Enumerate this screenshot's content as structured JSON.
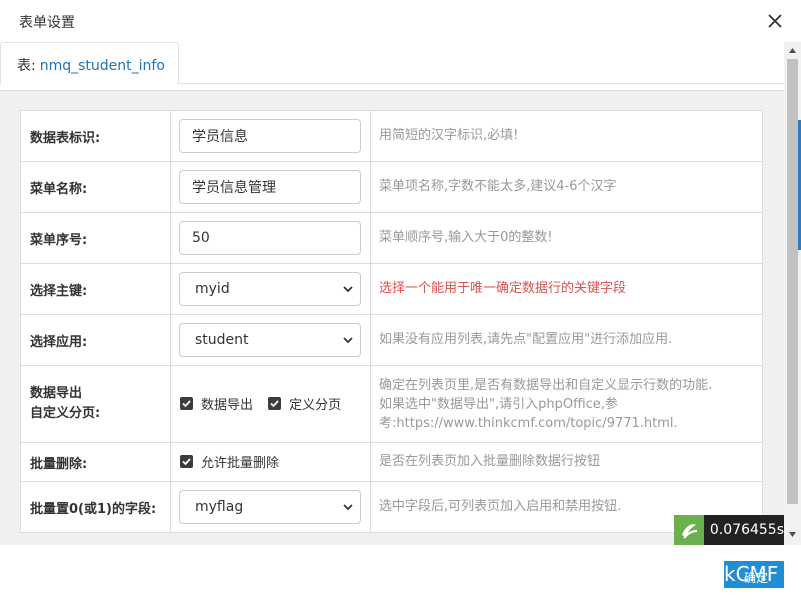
{
  "dialog": {
    "title": "表单设置"
  },
  "tab": {
    "prefix": "表:",
    "name": "nmq_student_info"
  },
  "rows": [
    {
      "label": "数据表标识:",
      "value": "学员信息",
      "hint": "用简短的汉字标识,必填!"
    },
    {
      "label": "菜单名称:",
      "value": "学员信息管理",
      "hint": "菜单项名称,字数不能太多,建议4-6个汉字"
    },
    {
      "label": "菜单序号:",
      "value": "50",
      "hint": "菜单顺序号,输入大于0的整数!"
    },
    {
      "label": "选择主键:",
      "value": "myid",
      "hint": "选择一个能用于唯一确定数据行的关键字段"
    },
    {
      "label": "选择应用:",
      "value": "student",
      "hint": "如果没有应用列表,请先点\"配置应用\"进行添加应用."
    },
    {
      "label_line1": "数据导出",
      "label_line2": "自定义分页:",
      "check1": "数据导出",
      "check2": "定义分页",
      "hint_line1": "确定在列表页里,是否有数据导出和自定义显示行数的功能.",
      "hint_line2": "如果选中\"数据导出\",请引入phpOffice,参",
      "hint_line3": "考:https://www.thinkcmf.com/topic/9771.html."
    },
    {
      "label": "批量删除:",
      "check": "允许批量删除",
      "hint": "是否在列表页加入批量删除数据行按钮"
    },
    {
      "label": "批量置0(或1)的字段:",
      "value": "myflag",
      "hint": "选中字段后,可列表页加入启用和禁用按钮."
    }
  ],
  "timer": {
    "value": "0.076455s"
  },
  "cmf_badge": {
    "text": "kCMF",
    "overlay": "确定"
  },
  "colors": {
    "link_blue": "#1e73b8",
    "hint_gray": "#999999",
    "hint_red": "#d9534f",
    "logo_green": "#6ab04c",
    "badge_blue": "#1e8fd6"
  }
}
